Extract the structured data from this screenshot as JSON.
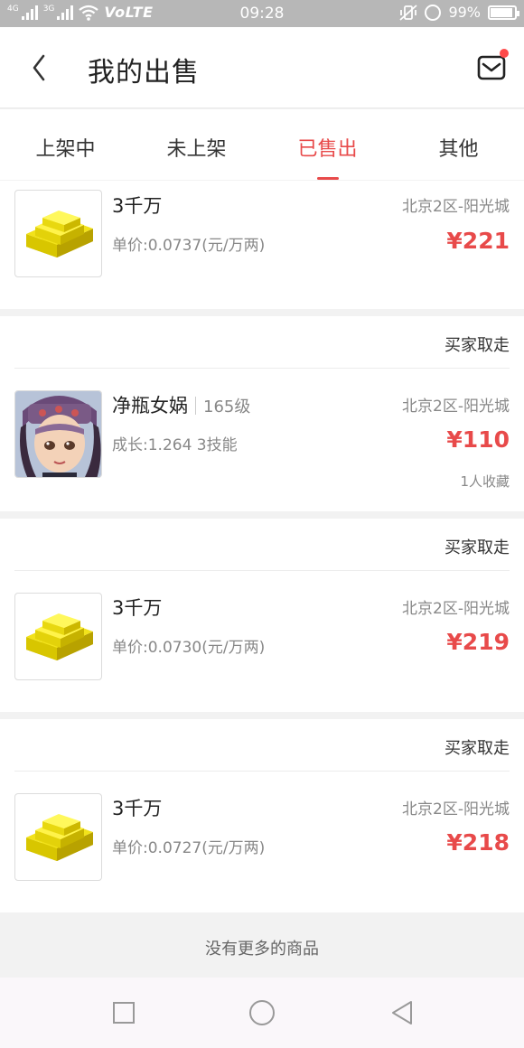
{
  "status_bar": {
    "net1": "4G",
    "net2": "3G",
    "volte": "VoLTE",
    "time": "09:28",
    "battery_pct": "99%"
  },
  "header": {
    "title": "我的出售",
    "back_icon": "chevron-left-icon",
    "message_icon": "mail-icon"
  },
  "tabs": [
    {
      "label": "上架中",
      "active": false
    },
    {
      "label": "未上架",
      "active": false
    },
    {
      "label": "已售出",
      "active": true
    },
    {
      "label": "其他",
      "active": false
    }
  ],
  "items": [
    {
      "name": "3千万",
      "sub": "单价:0.0737(元/万两)",
      "server": "北京2区-阳光城",
      "price": "¥221"
    },
    {
      "status": "买家取走",
      "name": "净瓶女娲",
      "level": "165级",
      "sub": "成长:1.264 3技能",
      "server": "北京2区-阳光城",
      "price": "¥110",
      "favs": "1人收藏"
    },
    {
      "status": "买家取走",
      "name": "3千万",
      "sub": "单价:0.0730(元/万两)",
      "server": "北京2区-阳光城",
      "price": "¥219"
    },
    {
      "status": "买家取走",
      "name": "3千万",
      "sub": "单价:0.0727(元/万两)",
      "server": "北京2区-阳光城",
      "price": "¥218"
    }
  ],
  "footer_note": "没有更多的商品",
  "colors": {
    "accent": "#e84a4a",
    "status_bar": "#b7b7b7",
    "dot": "#ff4a4a"
  }
}
